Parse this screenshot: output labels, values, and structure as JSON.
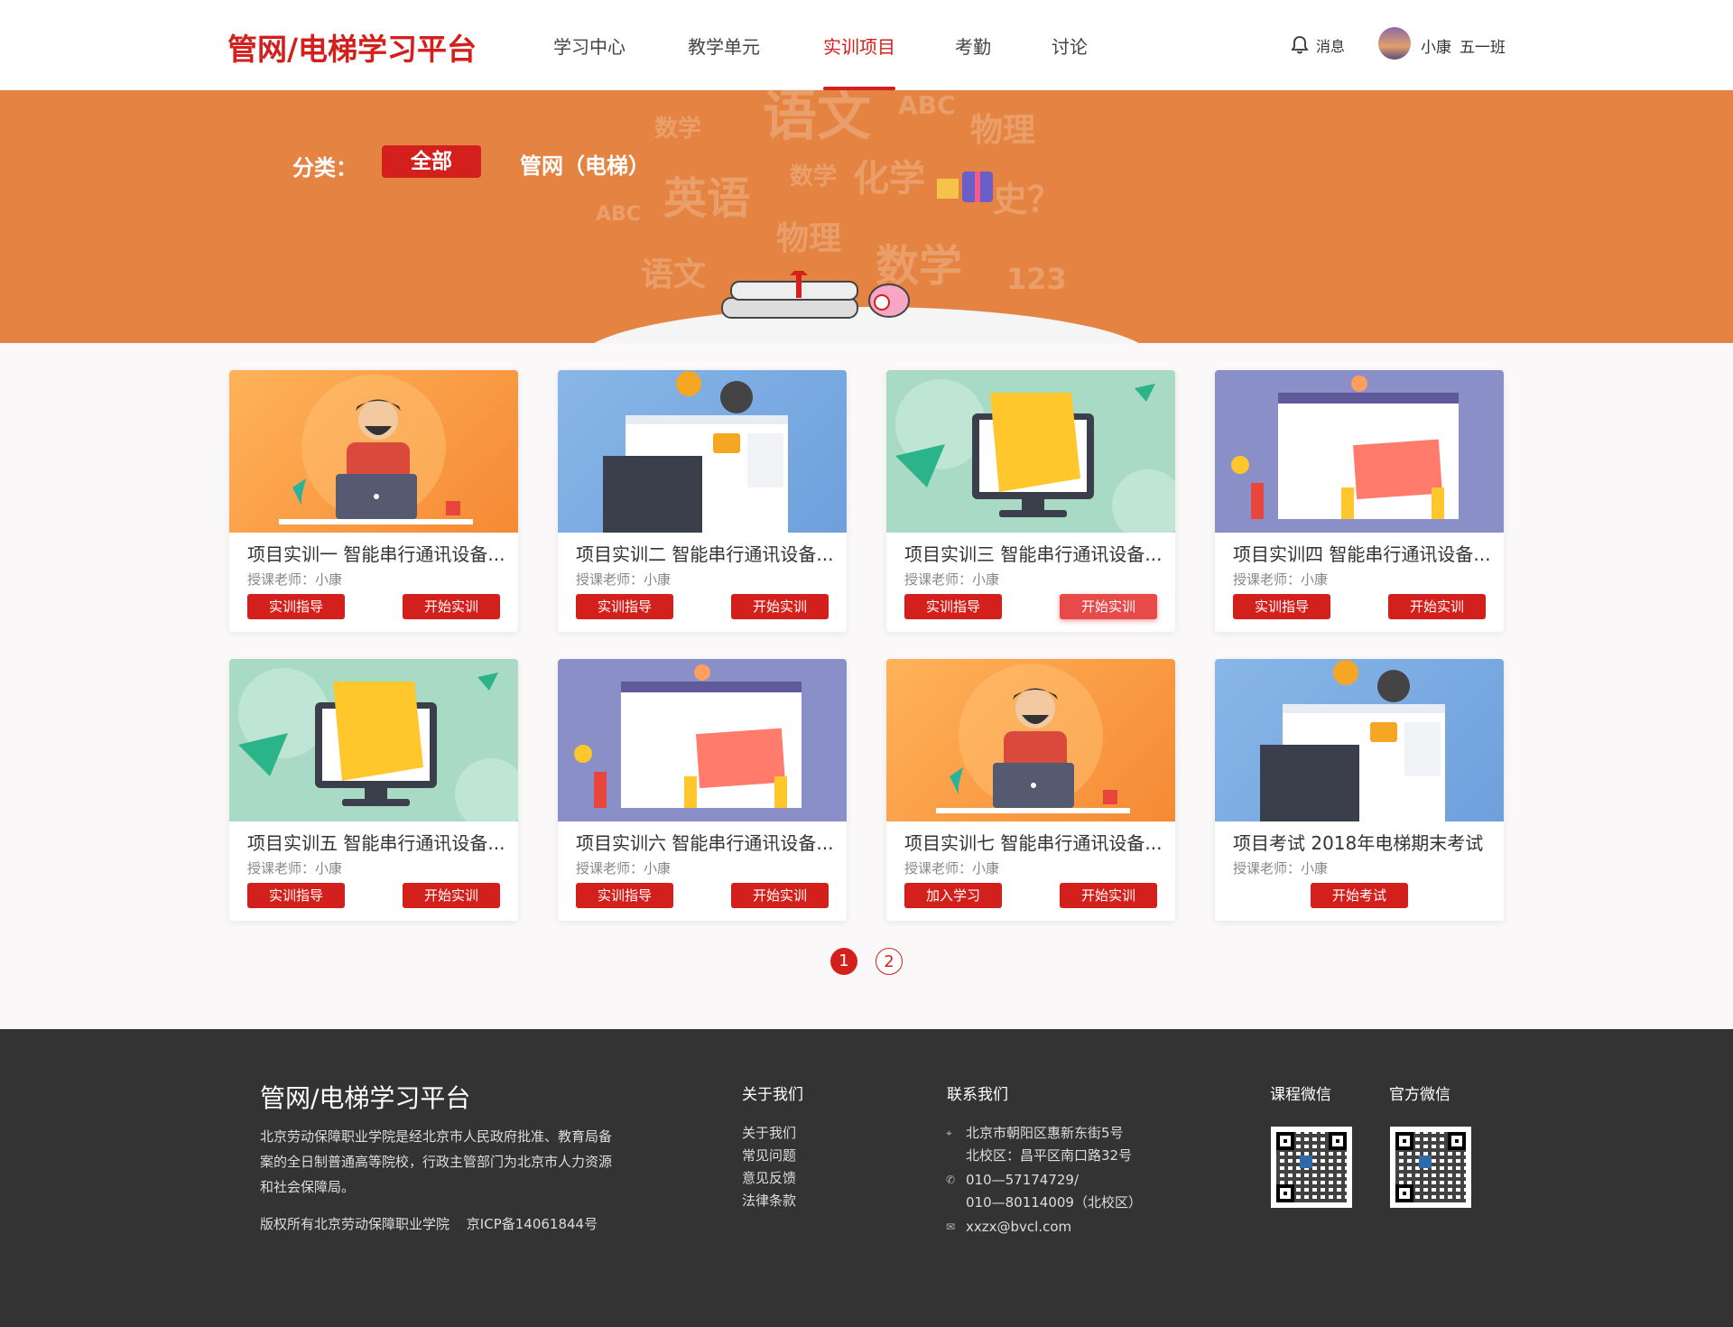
{
  "header": {
    "logo": "管网/电梯学习平台",
    "nav": [
      "学习中心",
      "教学单元",
      "实训项目",
      "考勤",
      "讨论"
    ],
    "active_nav": "实训项目",
    "messages_label": "消息",
    "user_name": "小康",
    "user_class": "五一班"
  },
  "banner": {
    "category_label": "分类：",
    "categories": [
      "全部",
      "管网（电梯）"
    ],
    "selected_category": "全部"
  },
  "cards": [
    {
      "title": "项目实训一 智能串行通讯设备...",
      "teacher": "授课老师：小康",
      "buttons": [
        "实训指导",
        "开始实训"
      ],
      "theme": "orange"
    },
    {
      "title": "项目实训二 智能串行通讯设备...",
      "teacher": "授课老师：小康",
      "buttons": [
        "实训指导",
        "开始实训"
      ],
      "theme": "blue"
    },
    {
      "title": "项目实训三 智能串行通讯设备...",
      "teacher": "授课老师：小康",
      "buttons": [
        "实训指导",
        "开始实训"
      ],
      "theme": "green"
    },
    {
      "title": "项目实训四 智能串行通讯设备...",
      "teacher": "授课老师：小康",
      "buttons": [
        "实训指导",
        "开始实训"
      ],
      "theme": "purple"
    },
    {
      "title": "项目实训五 智能串行通讯设备...",
      "teacher": "授课老师：小康",
      "buttons": [
        "实训指导",
        "开始实训"
      ],
      "theme": "green"
    },
    {
      "title": "项目实训六 智能串行通讯设备...",
      "teacher": "授课老师：小康",
      "buttons": [
        "实训指导",
        "开始实训"
      ],
      "theme": "purple"
    },
    {
      "title": "项目实训七 智能串行通讯设备...",
      "teacher": "授课老师：小康",
      "buttons": [
        "加入学习",
        "开始实训"
      ],
      "theme": "orange"
    },
    {
      "title": "项目考试 2018年电梯期末考试",
      "teacher": "授课老师：小康",
      "buttons": [
        "开始考试"
      ],
      "theme": "blue"
    }
  ],
  "pagination": {
    "pages": [
      "1",
      "2"
    ],
    "current": "1"
  },
  "footer": {
    "logo": "管网/电梯学习平台",
    "description": "北京劳动保障职业学院是经北京市人民政府批准、教育局备案的全日制普通高等院校，行政主管部门为北京市人力资源和社会保障局。",
    "copyright": "版权所有北京劳动保障职业学院",
    "icp": "京ICP备14061844号",
    "about_title": "关于我们",
    "about_links": [
      "关于我们",
      "常见问题",
      "意见反馈",
      "法律条款"
    ],
    "contact_title": "联系我们",
    "address_1": "北京市朝阳区惠新东街5号",
    "address_2": "北校区：昌平区南口路32号",
    "phone_1": "010—57174729/",
    "phone_2": "010—80114009（北校区）",
    "email": "xxzx@bvcl.com",
    "qr_1_label": "课程微信",
    "qr_2_label": "官方微信"
  },
  "colors": {
    "brand": "#d4201c",
    "banner": "#e58442",
    "footer": "#333333"
  }
}
